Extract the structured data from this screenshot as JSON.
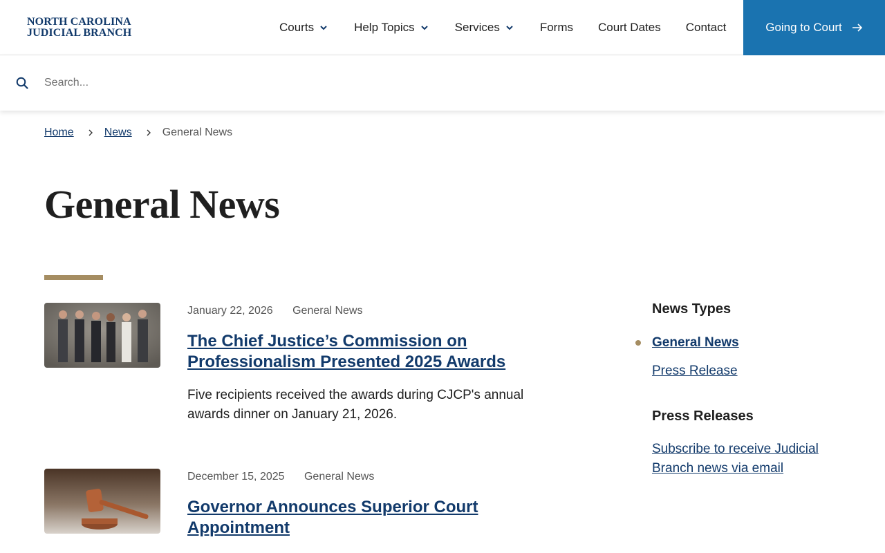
{
  "header": {
    "logo_line1": "NORTH CAROLINA",
    "logo_line2": "JUDICIAL BRANCH",
    "nav": [
      {
        "label": "Courts",
        "dropdown": true
      },
      {
        "label": "Help Topics",
        "dropdown": true
      },
      {
        "label": "Services",
        "dropdown": true
      },
      {
        "label": "Forms",
        "dropdown": false
      },
      {
        "label": "Court Dates",
        "dropdown": false
      },
      {
        "label": "Contact",
        "dropdown": false
      }
    ],
    "cta_label": "Going to Court"
  },
  "search": {
    "placeholder": "Search..."
  },
  "breadcrumb": {
    "home": "Home",
    "news": "News",
    "current": "General News"
  },
  "page": {
    "title": "General News"
  },
  "articles": [
    {
      "date": "January 22, 2026",
      "category": "General News",
      "title": "The Chief Justice’s Commission on Professionalism Presented 2025 Awards",
      "description": "Five recipients received the awards during CJCP's annual awards dinner on January 21, 2026."
    },
    {
      "date": "December 15, 2025",
      "category": "General News",
      "title": "Governor Announces Superior Court Appointment",
      "description": ""
    }
  ],
  "sidebar": {
    "news_types_heading": "News Types",
    "news_types": [
      {
        "label": "General News",
        "active": true
      },
      {
        "label": "Press Release",
        "active": false
      }
    ],
    "press_heading": "Press Releases",
    "subscribe_link": "Subscribe to receive Judicial Branch news via email"
  },
  "colors": {
    "brand_navy": "#123a6b",
    "cta_blue": "#1a73b0",
    "accent_gold": "#a58d62"
  },
  "icons": {
    "search": "search-icon",
    "dropdown": "chevron-down-icon",
    "cta_arrow": "arrow-right-icon",
    "breadcrumb_sep": "chevron-right-icon"
  }
}
